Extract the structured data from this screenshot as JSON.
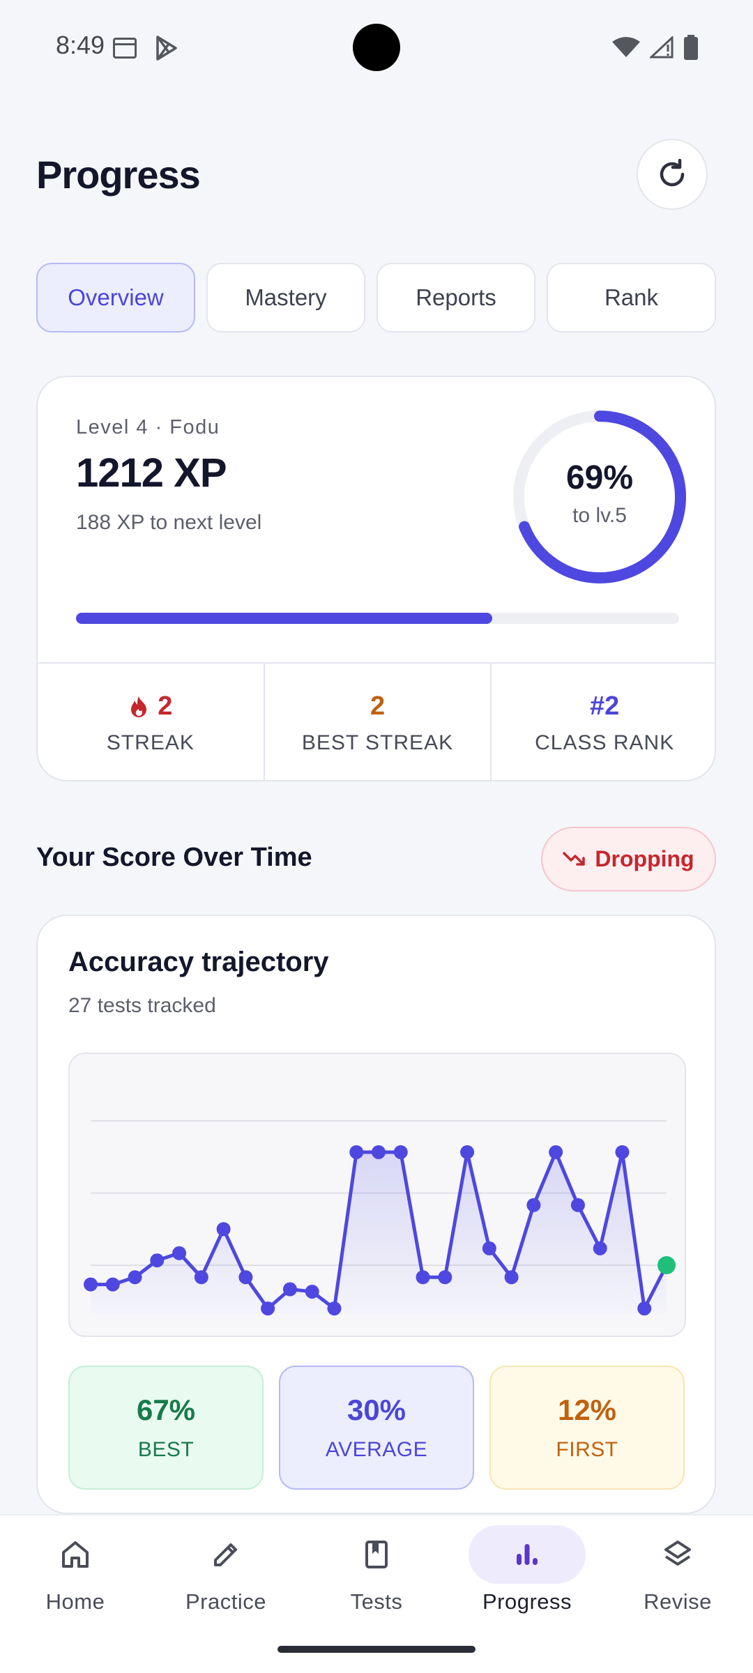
{
  "status_bar": {
    "time": "8:49"
  },
  "header": {
    "title": "Progress"
  },
  "tabs": [
    {
      "label": "Overview",
      "active": true
    },
    {
      "label": "Mastery",
      "active": false
    },
    {
      "label": "Reports",
      "active": false
    },
    {
      "label": "Rank",
      "active": false
    }
  ],
  "level": {
    "label": "Level 4 · Fodu",
    "xp": "1212 XP",
    "to_next": "188 XP to next level",
    "progress_percent": "69%",
    "progress_fraction": 0.69,
    "ring_sub": "to lv.5"
  },
  "stats": [
    {
      "value": "2",
      "label": "STREAK",
      "icon": "flame-icon",
      "color": "#c6262d"
    },
    {
      "value": "2",
      "label": "BEST STREAK",
      "color": "#c0610f"
    },
    {
      "value": "#2",
      "label": "CLASS RANK",
      "color": "#4b46d8"
    }
  ],
  "score_section": {
    "title": "Your Score Over Time",
    "trend_label": "Dropping",
    "trend_icon": "trending-down-icon"
  },
  "chart_card": {
    "title": "Accuracy trajectory",
    "subtitle": "27 tests tracked"
  },
  "chart_data": {
    "type": "line",
    "x": [
      1,
      2,
      3,
      4,
      5,
      6,
      7,
      8,
      9,
      10,
      11,
      12,
      13,
      14,
      15,
      16,
      17,
      18,
      19,
      20,
      21,
      22,
      23,
      24,
      25,
      26,
      27
    ],
    "values": [
      12,
      12,
      15,
      22,
      25,
      15,
      35,
      15,
      2,
      10,
      9,
      2,
      67,
      67,
      67,
      15,
      15,
      67,
      27,
      15,
      45,
      67,
      45,
      27,
      67,
      2,
      20
    ],
    "ylim": [
      0,
      100
    ],
    "gridlines": [
      20,
      50,
      80
    ],
    "grid": true,
    "line_color": "#4e48e0",
    "last_point_color": "#1fbf7a"
  },
  "summary": {
    "best": {
      "value": "67%",
      "label": "BEST"
    },
    "average": {
      "value": "30%",
      "label": "AVERAGE"
    },
    "first": {
      "value": "12%",
      "label": "FIRST"
    }
  },
  "nav": [
    {
      "label": "Home",
      "icon": "home-icon",
      "active": false
    },
    {
      "label": "Practice",
      "icon": "pencil-icon",
      "active": false
    },
    {
      "label": "Tests",
      "icon": "bookmark-book-icon",
      "active": false
    },
    {
      "label": "Progress",
      "icon": "bar-chart-icon",
      "active": true
    },
    {
      "label": "Revise",
      "icon": "layers-icon",
      "active": false
    }
  ]
}
